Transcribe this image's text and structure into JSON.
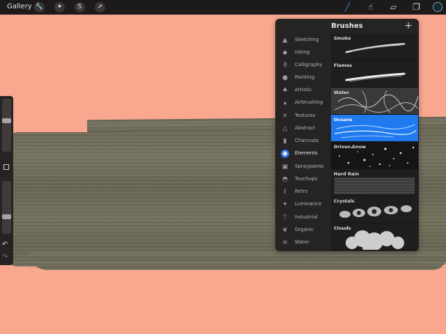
{
  "topbar": {
    "gallery_label": "Gallery",
    "left_icons": [
      {
        "name": "wrench-icon",
        "glyph": "🔧"
      },
      {
        "name": "magic-wand-icon",
        "glyph": "✦"
      },
      {
        "name": "selection-icon",
        "glyph": "S"
      },
      {
        "name": "transform-arrow-icon",
        "glyph": "➚"
      }
    ],
    "right_tools": [
      {
        "name": "brush-tool",
        "glyph": "╱",
        "active": true,
        "color": "#2f8cff"
      },
      {
        "name": "smudge-tool",
        "glyph": "☝",
        "active": false
      },
      {
        "name": "eraser-tool",
        "glyph": "▱",
        "active": false
      },
      {
        "name": "layers-tool",
        "glyph": "❐",
        "active": false
      }
    ],
    "current_color": "#0f2a33"
  },
  "sidebar": {
    "size_slider_level": 0.33,
    "opacity_slider_level": 0.6,
    "undo_glyph": "↶",
    "redo_glyph": "↷"
  },
  "brushes_panel": {
    "title": "Brushes",
    "add_glyph": "+",
    "categories": [
      {
        "label": "Sketching",
        "icon": "▲"
      },
      {
        "label": "Inking",
        "icon": "◆"
      },
      {
        "label": "Calligraphy",
        "icon": "ϑ"
      },
      {
        "label": "Painting",
        "icon": "●"
      },
      {
        "label": "Artistic",
        "icon": "♠"
      },
      {
        "label": "Airbrushing",
        "icon": "▴"
      },
      {
        "label": "Textures",
        "icon": "✕"
      },
      {
        "label": "Abstract",
        "icon": "△"
      },
      {
        "label": "Charcoals",
        "icon": "▮"
      },
      {
        "label": "Elements",
        "icon": "◉",
        "selected": true
      },
      {
        "label": "Spraypaints",
        "icon": "▣"
      },
      {
        "label": "Touchups",
        "icon": "◓"
      },
      {
        "label": "Retro",
        "icon": "ℓ"
      },
      {
        "label": "Luminance",
        "icon": "✦"
      },
      {
        "label": "Industrial",
        "icon": "⊤"
      },
      {
        "label": "Organic",
        "icon": "❦"
      },
      {
        "label": "Water",
        "icon": "≋"
      }
    ],
    "brushes": [
      {
        "name": "Smoke",
        "preview": "stroke"
      },
      {
        "name": "Flames",
        "preview": "stroke"
      },
      {
        "name": "Water",
        "preview": "caustic"
      },
      {
        "name": "Oceans",
        "preview": "waves",
        "selected": true
      },
      {
        "name": "Driven Snow",
        "preview": "dots"
      },
      {
        "name": "Hard Rain",
        "preview": "noise"
      },
      {
        "name": "Crystals",
        "preview": "crystal"
      },
      {
        "name": "Clouds",
        "preview": "cloud"
      }
    ]
  }
}
